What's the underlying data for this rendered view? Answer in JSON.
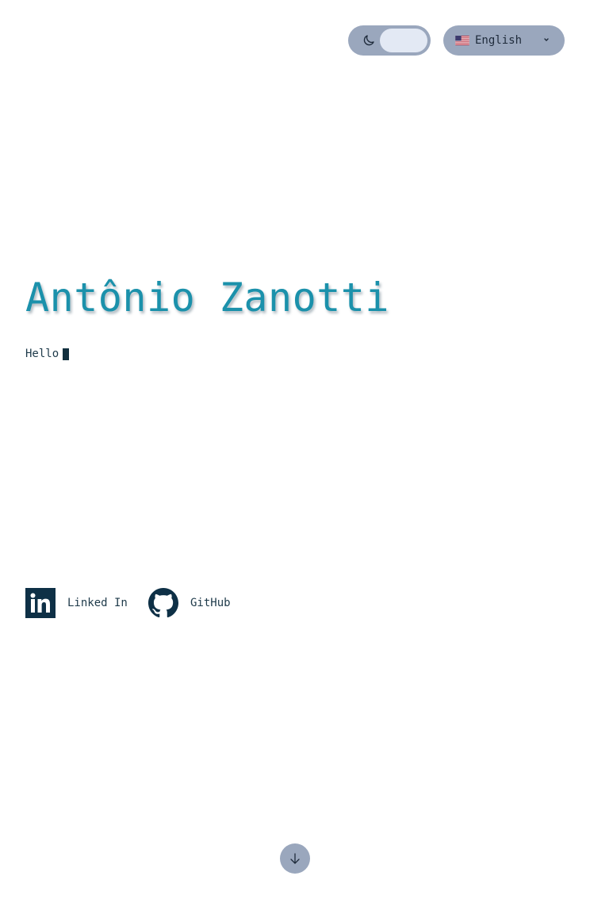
{
  "header": {
    "theme_toggle": {
      "icon": "moon-icon",
      "mode": "light"
    },
    "language": {
      "flag_icon": "us-flag-icon",
      "selected": "English"
    }
  },
  "hero": {
    "name": "Antônio Zanotti",
    "typed_text": "Hello"
  },
  "social_links": [
    {
      "icon": "linkedin-icon",
      "label": "Linked In"
    },
    {
      "icon": "github-icon",
      "label": "GitHub"
    }
  ],
  "scroll_button": {
    "icon": "arrow-down-icon"
  },
  "colors": {
    "accent": "#1b91ab",
    "control_bg": "#9aa7bd",
    "knob": "#e3e9f4",
    "text": "#1e3a4a",
    "linkedin": "#0e3046"
  }
}
